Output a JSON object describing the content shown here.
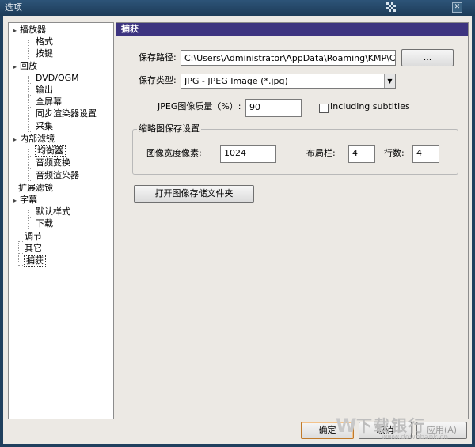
{
  "window": {
    "title": "选项",
    "close_glyph": "✕"
  },
  "tree": {
    "items": [
      {
        "label": "播放器",
        "level": 0,
        "expander": "▸"
      },
      {
        "label": "格式",
        "level": 1
      },
      {
        "label": "按键",
        "level": 1
      },
      {
        "label": "回放",
        "level": 0,
        "expander": "▸"
      },
      {
        "label": "DVD/OGM",
        "level": 1
      },
      {
        "label": "输出",
        "level": 1
      },
      {
        "label": "全屏幕",
        "level": 1
      },
      {
        "label": "同步渲染器设置",
        "level": 1
      },
      {
        "label": "采集",
        "level": 1
      },
      {
        "label": "内部滤镜",
        "level": 0,
        "expander": "▸"
      },
      {
        "label": "均衡器",
        "level": 1,
        "selected": true
      },
      {
        "label": "音频变换",
        "level": 1
      },
      {
        "label": "音频渲染器",
        "level": 1
      },
      {
        "label": "扩展滤镜",
        "level": 0
      },
      {
        "label": "字幕",
        "level": 0,
        "expander": "▸"
      },
      {
        "label": "默认样式",
        "level": 1
      },
      {
        "label": "下载",
        "level": 1
      },
      {
        "label": "调节",
        "level": 0
      },
      {
        "label": "其它",
        "level": 0
      },
      {
        "label": "捕获",
        "level": 0
      }
    ]
  },
  "panel": {
    "header": "捕获",
    "save_path_label": "保存路径:",
    "save_path_value": "C:\\Users\\Administrator\\AppData\\Roaming\\KMP\\Capture",
    "browse_label": "...",
    "save_type_label": "保存类型:",
    "save_type_value": "JPG - JPEG Image (*.jpg)",
    "jpeg_quality_label": "JPEG图像质量（%）:",
    "jpeg_quality_value": "90",
    "include_subtitles_label": "Including subtitles",
    "include_subtitles_checked": false,
    "thumb_group_title": "缩略图保存设置",
    "image_width_label": "图像宽度像素:",
    "image_width_value": "1024",
    "layout_cols_label": "布局栏:",
    "layout_cols_value": "4",
    "rows_label": "行数:",
    "rows_value": "4",
    "open_folder_label": "打开图像存储文件夹"
  },
  "footer": {
    "ok_label": "确定",
    "cancel_label": "取消",
    "apply_label": "应用(A)"
  },
  "watermark": {
    "text": "下载银行",
    "url": "www.downbank.cn"
  },
  "colors": {
    "header_bg": "#3d3480",
    "titlebar_bg": "#20405e",
    "client_bg": "#ece9e4"
  }
}
